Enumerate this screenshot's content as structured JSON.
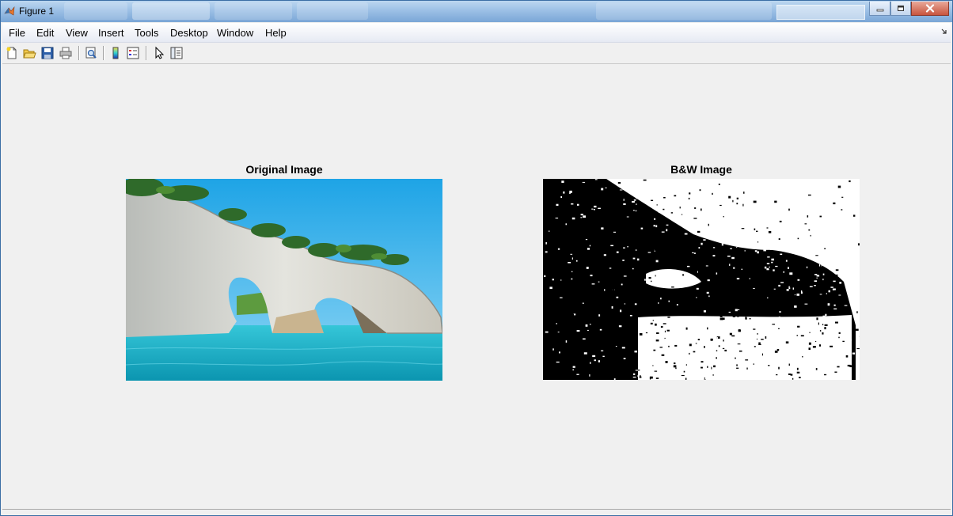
{
  "window": {
    "title": "Figure 1"
  },
  "menu": {
    "items": [
      "File",
      "Edit",
      "View",
      "Insert",
      "Tools",
      "Desktop",
      "Window",
      "Help"
    ]
  },
  "toolbar": {
    "icons": [
      "new-figure-icon",
      "open-file-icon",
      "save-icon",
      "print-icon",
      "print-preview-icon",
      "insert-colorbar-icon",
      "insert-legend-icon",
      "edit-plot-icon",
      "show-plot-tools-icon"
    ]
  },
  "axes": [
    {
      "title": "Original Image"
    },
    {
      "title": "B&W Image"
    }
  ],
  "colors": {
    "sky": "#3fb6ea",
    "sea": "#17b3c9",
    "rock": "#d9dbd6",
    "tree": "#2f6a2a"
  }
}
